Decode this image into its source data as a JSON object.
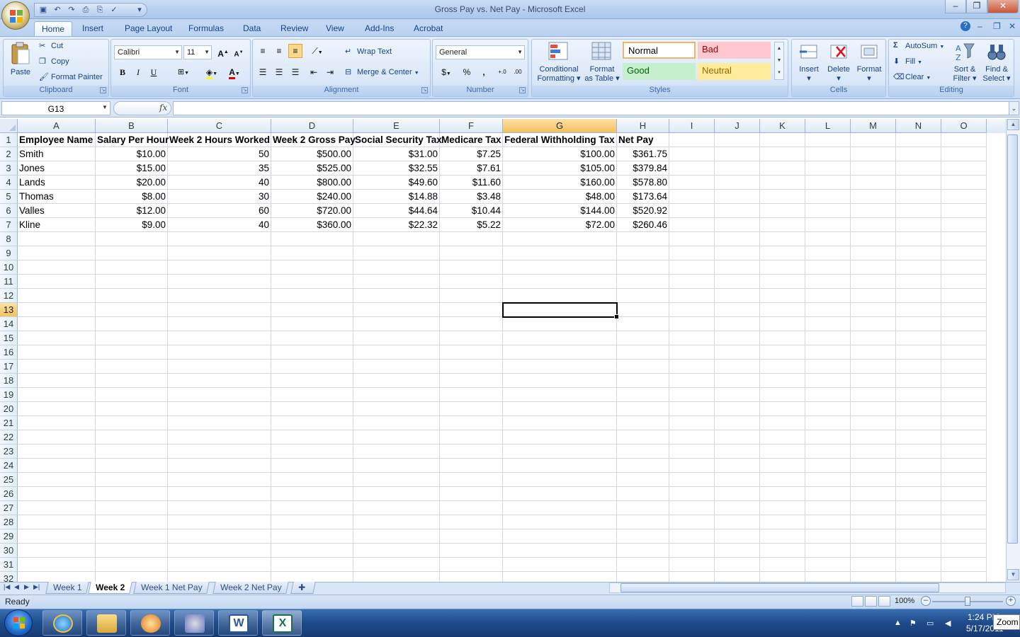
{
  "window": {
    "title": "Gross Pay vs. Net Pay - Microsoft Excel",
    "min_label": "–",
    "max_label": "❐",
    "close_label": "✕"
  },
  "ribbon_tabs": [
    "Home",
    "Insert",
    "Page Layout",
    "Formulas",
    "Data",
    "Review",
    "View",
    "Add-Ins",
    "Acrobat"
  ],
  "ribbon": {
    "clipboard": {
      "label": "Clipboard",
      "paste": "Paste",
      "cut": "Cut",
      "copy": "Copy",
      "format_painter": "Format Painter"
    },
    "font": {
      "label": "Font",
      "family": "Calibri",
      "size": "11",
      "bold": "B",
      "italic": "I",
      "underline": "U"
    },
    "alignment": {
      "label": "Alignment",
      "wrap_text": "Wrap Text",
      "merge_center": "Merge & Center"
    },
    "number": {
      "label": "Number",
      "format": "General",
      "currency": "$",
      "percent": "%",
      "comma": ",",
      "inc_decimal": "+.0",
      "dec_decimal": ".00"
    },
    "styles": {
      "label": "Styles",
      "conditional": "Conditional",
      "conditional2": "Formatting",
      "format_table": "Format",
      "format_table2": "as Table",
      "normal": "Normal",
      "bad": "Bad",
      "good": "Good",
      "neutral": "Neutral"
    },
    "cells": {
      "label": "Cells",
      "insert": "Insert",
      "delete": "Delete",
      "format": "Format"
    },
    "editing": {
      "label": "Editing",
      "autosum": "AutoSum",
      "fill": "Fill",
      "clear": "Clear",
      "sort": "Sort &",
      "sort2": "Filter",
      "find": "Find &",
      "find2": "Select"
    }
  },
  "formula_bar": {
    "name_box": "G13",
    "fx": "fx",
    "value": ""
  },
  "columns": [
    "A",
    "B",
    "C",
    "D",
    "E",
    "F",
    "G",
    "H",
    "I",
    "J",
    "K",
    "L",
    "M",
    "N",
    "O"
  ],
  "selected_cell": {
    "col": "G",
    "row": 13
  },
  "sheet": {
    "headers": [
      "Employee Name",
      "Salary Per Hour",
      "Week 2 Hours Worked",
      "Week 2 Gross Pay",
      "Social Security Tax",
      "Medicare Tax",
      "Federal Withholding Tax",
      "Net Pay"
    ],
    "rows": [
      [
        "Smith",
        "$10.00",
        "50",
        "$500.00",
        "$31.00",
        "$7.25",
        "$100.00",
        "$361.75"
      ],
      [
        "Jones",
        "$15.00",
        "35",
        "$525.00",
        "$32.55",
        "$7.61",
        "$105.00",
        "$379.84"
      ],
      [
        "Lands",
        "$20.00",
        "40",
        "$800.00",
        "$49.60",
        "$11.60",
        "$160.00",
        "$578.80"
      ],
      [
        "Thomas",
        "$8.00",
        "30",
        "$240.00",
        "$14.88",
        "$3.48",
        "$48.00",
        "$173.64"
      ],
      [
        "Valles",
        "$12.00",
        "60",
        "$720.00",
        "$44.64",
        "$10.44",
        "$144.00",
        "$520.92"
      ],
      [
        "Kline",
        "$9.00",
        "40",
        "$360.00",
        "$22.32",
        "$5.22",
        "$72.00",
        "$260.46"
      ]
    ],
    "row_numbers": [
      "1",
      "2",
      "3",
      "4",
      "5",
      "6",
      "7",
      "8",
      "9",
      "10",
      "11",
      "12",
      "13",
      "14",
      "15",
      "16",
      "17",
      "18",
      "19",
      "20",
      "21",
      "22",
      "23",
      "24",
      "25",
      "26",
      "27",
      "28",
      "29",
      "30",
      "31",
      "32"
    ]
  },
  "sheet_tabs": [
    "Week 1",
    "Week 2",
    "Week 1 Net Pay",
    "Week 2 Net Pay"
  ],
  "active_sheet": "Week 2",
  "status": {
    "text": "Ready",
    "zoom": "100%"
  },
  "taskbar": {
    "time": "1:24 PM",
    "date": "5/17/2011",
    "zoom_badge": "Zoom"
  },
  "colors": {
    "accent": "#15428b",
    "selected_header": "#f5c15a",
    "bad_bg": "#ffc7ce",
    "good_bg": "#c6efce",
    "neutral_bg": "#ffeb9c",
    "excel_green": "#1e7145"
  }
}
